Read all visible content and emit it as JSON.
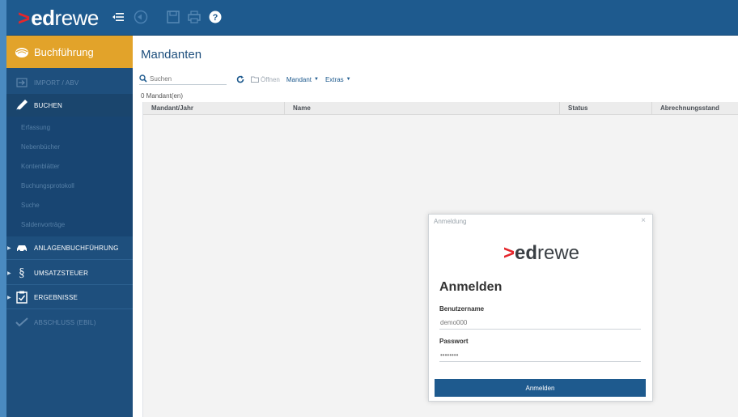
{
  "app": {
    "logo_chevron": ">",
    "logo_ed": "ed",
    "logo_rewe": "rewe"
  },
  "topbar": {
    "icons": [
      "menu-collapse-icon",
      "back-icon",
      "save-icon",
      "print-icon",
      "help-icon"
    ]
  },
  "sidebar": {
    "header_label": "Buchführung",
    "items": [
      {
        "label": "IMPORT / ABV",
        "icon": "import-icon",
        "disabled": true
      },
      {
        "label": "BUCHEN",
        "icon": "pen-icon",
        "disabled": false
      },
      {
        "label": "ANLAGENBUCHFÜHRUNG",
        "icon": "car-icon",
        "disabled": false
      },
      {
        "label": "UMSATZSTEUER",
        "icon": "paragraph-icon",
        "disabled": false
      },
      {
        "label": "ERGEBNISSE",
        "icon": "clipboard-check-icon",
        "disabled": false
      },
      {
        "label": "ABSCHLUSS (EBIL)",
        "icon": "checkmark-icon",
        "disabled": true
      }
    ],
    "subitems": [
      "Erfassung",
      "Nebenbücher",
      "Kontenblätter",
      "Buchungsprotokoll",
      "Suche",
      "Saldenvorträge"
    ]
  },
  "main": {
    "title": "Mandanten",
    "search_placeholder": "Suchen",
    "toolbar": {
      "open_label": "Öffnen",
      "mandant_label": "Mandant",
      "extras_label": "Extras"
    },
    "count_text": "0 Mandant(en)",
    "columns": [
      "Mandant/Jahr",
      "Name",
      "Status",
      "Abrechnungsstand"
    ]
  },
  "dialog": {
    "title": "Anmeldung",
    "close": "×",
    "heading": "Anmelden",
    "username_label": "Benutzername",
    "username_value": "demo000",
    "password_label": "Passwort",
    "password_value": "••••••••",
    "submit_label": "Anmelden"
  },
  "colors": {
    "primary": "#1e5a8e",
    "accent": "#e2a32a",
    "brand_red": "#e5262b"
  }
}
